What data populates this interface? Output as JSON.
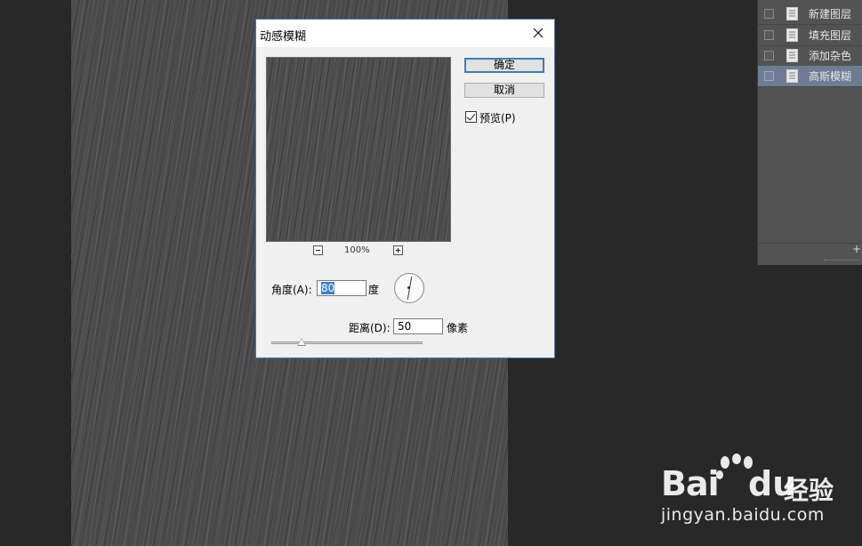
{
  "layers_panel": {
    "layers": [
      {
        "name": "新建图层",
        "selected": false
      },
      {
        "name": "填充图层",
        "selected": false
      },
      {
        "name": "添加杂色",
        "selected": false
      },
      {
        "name": "高斯模糊",
        "selected": true
      }
    ]
  },
  "dialog": {
    "title": "动感模糊",
    "ok_label": "确定",
    "cancel_label": "取消",
    "preview_label": "预览(P)",
    "preview_checked": true,
    "zoom_level": "100%",
    "angle_label": "角度(A):",
    "angle_value": "80",
    "angle_unit": "度",
    "distance_label": "距离(D):",
    "distance_value": "50",
    "distance_unit": "像素",
    "distance_slider_fraction": 0.2
  },
  "watermark": {
    "brand_bai": "Bai",
    "brand_du": "du",
    "brand_jingyan": "经验",
    "url": "jingyan.baidu.com"
  },
  "colors": {
    "workspace": "#282828",
    "panel": "#535353",
    "selected_layer": "#6e7c93",
    "dialog_bg": "#f0f0f0",
    "dialog_border": "#4a7ab5",
    "default_button_border": "#3c7fb1",
    "selection_highlight": "#3a7ed6"
  }
}
